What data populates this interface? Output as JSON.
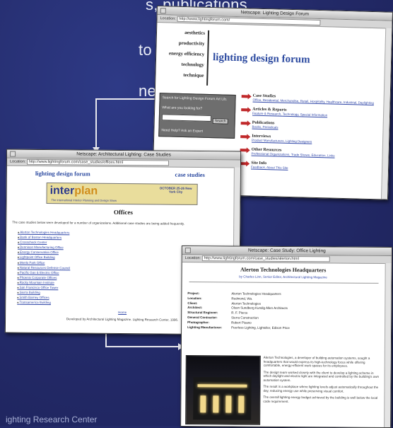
{
  "headline": {
    "line1": "s, publications",
    "line2": "to inter.Light at",
    "line3": "ne."
  },
  "footer_text": "ighting Research Center",
  "window1": {
    "title": "Netscape: Lighting Design Forum",
    "url": "http://www.lightingforum.com/",
    "nav": [
      "aesthetics",
      "productivity",
      "energy efficiency",
      "technology",
      "technique"
    ],
    "forum_title": "lighting design forum",
    "search": {
      "label": "Search for Lighting Design Forum Art Lib.",
      "prompt": "What are you looking for?",
      "button": "Search",
      "more": "Need Help? Ask an Expert"
    },
    "topics": [
      {
        "title": "Case Studies",
        "desc": "Office, Residential, Merchandise, Retail, Hospitality, Healthcare, Industrial, Daylighting"
      },
      {
        "title": "Articles & Reports",
        "desc": "Feature & Research, Technology, Special Information"
      },
      {
        "title": "Publications",
        "desc": "Books, Periodicals"
      },
      {
        "title": "Interviews",
        "desc": "Product Manufacturers, Lighting Designers"
      },
      {
        "title": "Other Resources",
        "desc": "Professional Organizations, Trade Shows, Education, Links"
      },
      {
        "title": "Site Info",
        "desc": "Feedback, About This Site"
      }
    ]
  },
  "window2": {
    "title": "Netscape: Architectural Lighting: Case Studies",
    "url": "http://www.lightingforum.com/case_studies/offices.html",
    "head_left": "lighting design forum",
    "head_right": "case studies",
    "banner": {
      "logo_a": "inter",
      "logo_b": "plan",
      "sub": "The international Interior Planning and Design Show",
      "date": "OCTOBER 25-26 New York City"
    },
    "section": "Offices",
    "intro": "The case studies below were developed for a number of organizations. Additional case studies are being added frequently.",
    "items": [
      "Alerton Technologies Headquarters",
      "Bank of Boston Headquarters",
      "Crosscheck Center",
      "Dennison Manufacturing Office",
      "Energy Conservation Office",
      "Lightpoint Office Building",
      "Menlo Park Office",
      "Natural Resources Defense Council",
      "Pacific Gas & Electric Office",
      "Phoenix Corporate Offices",
      "Rocky Mountain Institute",
      "San Francisco Office Tower",
      "Sierra Building",
      "Smith Barney Offices",
      "Transamerica Building"
    ],
    "footer_link": "Home",
    "footer_credit": "Developed by Architectural Lighting Magazine. Lighting Research Center, 1996."
  },
  "window3": {
    "title": "Netscape: Case Study: Office Lighting",
    "url": "http://www.lightingforum.com/case_studies/alerton.html",
    "heading": "Alerton Technologies Headquarters",
    "subheading": "by Charles Linn, Senior Editor, Architectural Lighting Magazine",
    "specs": [
      {
        "k": "Project:",
        "v": "Alerton Technologies Headquarters"
      },
      {
        "k": "Location:",
        "v": "Redmond, Wa."
      },
      {
        "k": "Client:",
        "v": "Alerton Technologies"
      },
      {
        "k": "Architect:",
        "v": "Olson Sundberg Kundig Allen Architects"
      },
      {
        "k": "Structural Engineer:",
        "v": "R. F. Pierce"
      },
      {
        "k": "General Contractor:",
        "v": "Sierra Construction"
      },
      {
        "k": "Photographer:",
        "v": "Robert Pisano"
      },
      {
        "k": "Lighting Manufacturer:",
        "v": "Peerless Lighting, Lightolier, Edison Price"
      }
    ],
    "paragraphs": [
      "Alerton Technologies, a developer of building automation systems, sought a headquarters that would express its high-technology focus while offering comfortable, energy-efficient work spaces for its employees.",
      "The design team worked closely with the client to develop a lighting scheme in which daylight and electric light are integrated and controlled by the building's own automation system.",
      "The result is a workplace where lighting levels adjust automatically throughout the day, reducing energy use while preserving visual comfort.",
      "The overall lighting energy budget achieved by the building is well below the local code requirement."
    ]
  }
}
